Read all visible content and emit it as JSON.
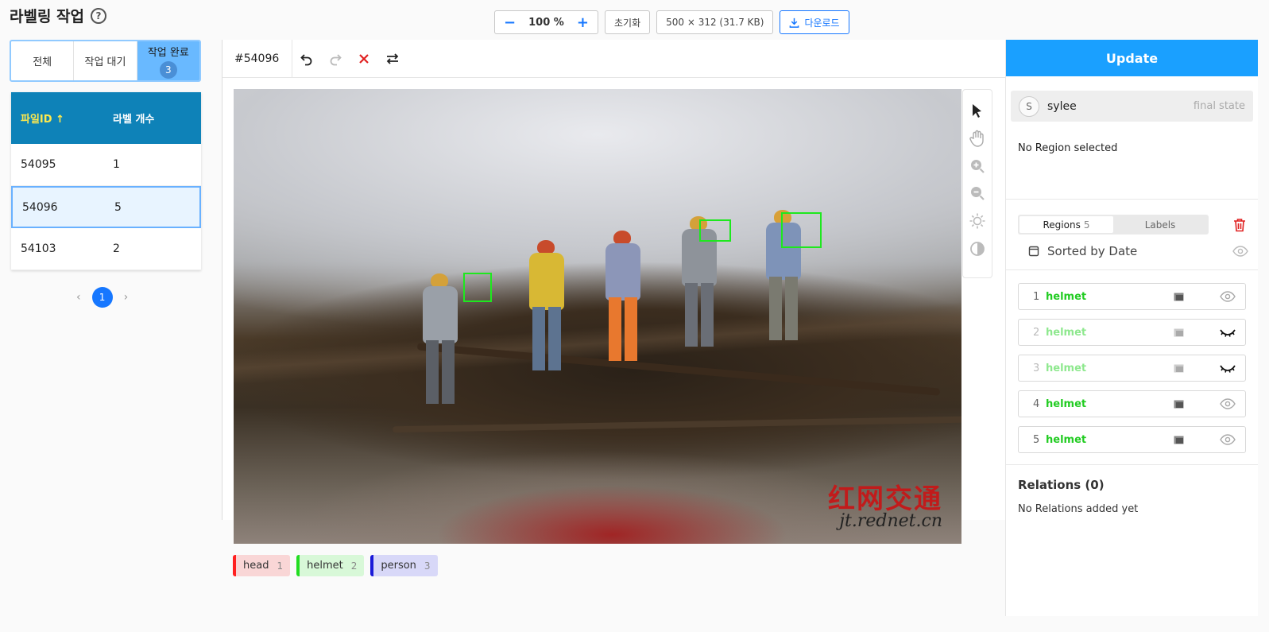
{
  "header": {
    "title": "라벨링 작업",
    "help": "?"
  },
  "toolbar": {
    "zoom_minus": "−",
    "zoom_value": "100 %",
    "zoom_plus": "+",
    "reset_label": "초기화",
    "image_info": "500 × 312 (31.7 KB)",
    "download_label": "다운로드"
  },
  "status_tabs": [
    {
      "label": "전체"
    },
    {
      "label": "작업 대기"
    },
    {
      "label": "작업 완료",
      "badge": "3"
    }
  ],
  "file_table": {
    "col_id": "파일ID ↑",
    "col_count": "라벨 개수",
    "rows": [
      {
        "id": "54095",
        "count": "1"
      },
      {
        "id": "54096",
        "count": "5"
      },
      {
        "id": "54103",
        "count": "2"
      }
    ]
  },
  "pagination": {
    "prev": "‹",
    "page": "1",
    "next": "›"
  },
  "editor": {
    "task_id": "#54096",
    "watermark_cn": "红网交通",
    "watermark_url": "jt.rednet.cn"
  },
  "legend": [
    {
      "label": "head",
      "count": "1",
      "color": "#ff2020",
      "bg": "#f9d6d6"
    },
    {
      "label": "helmet",
      "count": "2",
      "color": "#22dd22",
      "bg": "#d8f8d8"
    },
    {
      "label": "person",
      "count": "3",
      "color": "#1a1ad8",
      "bg": "#d8d8f8"
    }
  ],
  "sidebar": {
    "update_label": "Update",
    "user_initial": "S",
    "user_name": "sylee",
    "user_state": "final state",
    "no_region": "No Region selected",
    "regions_tab": "Regions",
    "regions_count": "5",
    "labels_tab": "Labels",
    "sort_label": "Sorted by Date",
    "regions": [
      {
        "num": "1",
        "label": "helmet",
        "hidden": false
      },
      {
        "num": "2",
        "label": "helmet",
        "hidden": true
      },
      {
        "num": "3",
        "label": "helmet",
        "hidden": true
      },
      {
        "num": "4",
        "label": "helmet",
        "hidden": false
      },
      {
        "num": "5",
        "label": "helmet",
        "hidden": false
      }
    ],
    "relations_title": "Relations (0)",
    "relations_empty": "No Relations added yet"
  },
  "colors": {
    "accent": "#1677ff",
    "update": "#1aa0ff",
    "bbox": "#1ee81e",
    "table_header": "#0e82b8"
  }
}
